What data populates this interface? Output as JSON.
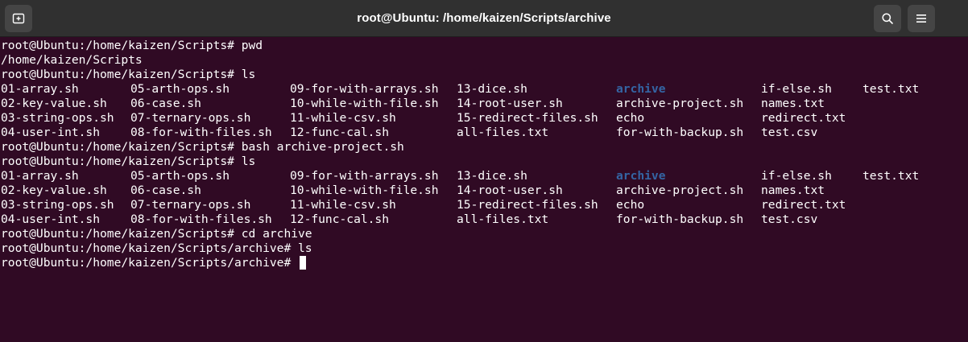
{
  "window": {
    "title": "root@Ubuntu: /home/kaizen/Scripts/archive"
  },
  "titlebar": {
    "new_tab_icon": "new-tab-icon",
    "search_icon": "search-icon",
    "menu_icon": "hamburger-menu-icon"
  },
  "colors": {
    "background": "#300a24",
    "titlebar": "#303030",
    "directory": "#3465a4",
    "text": "#ffffff"
  },
  "terminal": {
    "prompt1": "root@Ubuntu:/home/kaizen/Scripts# pwd",
    "output_pwd": "/home/kaizen/Scripts",
    "prompt2": "root@Ubuntu:/home/kaizen/Scripts# ls",
    "ls1": [
      [
        "01-array.sh",
        "05-arth-ops.sh",
        "09-for-with-arrays.sh",
        "13-dice.sh",
        "archive",
        "if-else.sh",
        "test.txt"
      ],
      [
        "02-key-value.sh",
        "06-case.sh",
        "10-while-with-file.sh",
        "14-root-user.sh",
        "archive-project.sh",
        "names.txt",
        ""
      ],
      [
        "03-string-ops.sh",
        "07-ternary-ops.sh",
        "11-while-csv.sh",
        "15-redirect-files.sh",
        "echo",
        "redirect.txt",
        ""
      ],
      [
        "04-user-int.sh",
        "08-for-with-files.sh",
        "12-func-cal.sh",
        "all-files.txt",
        "for-with-backup.sh",
        "test.csv",
        ""
      ]
    ],
    "prompt3": "root@Ubuntu:/home/kaizen/Scripts# bash archive-project.sh",
    "prompt4": "root@Ubuntu:/home/kaizen/Scripts# ls",
    "ls2": [
      [
        "01-array.sh",
        "05-arth-ops.sh",
        "09-for-with-arrays.sh",
        "13-dice.sh",
        "archive",
        "if-else.sh",
        "test.txt"
      ],
      [
        "02-key-value.sh",
        "06-case.sh",
        "10-while-with-file.sh",
        "14-root-user.sh",
        "archive-project.sh",
        "names.txt",
        ""
      ],
      [
        "03-string-ops.sh",
        "07-ternary-ops.sh",
        "11-while-csv.sh",
        "15-redirect-files.sh",
        "echo",
        "redirect.txt",
        ""
      ],
      [
        "04-user-int.sh",
        "08-for-with-files.sh",
        "12-func-cal.sh",
        "all-files.txt",
        "for-with-backup.sh",
        "test.csv",
        ""
      ]
    ],
    "prompt5": "root@Ubuntu:/home/kaizen/Scripts# cd archive",
    "prompt6": "root@Ubuntu:/home/kaizen/Scripts/archive# ls",
    "prompt7": "root@Ubuntu:/home/kaizen/Scripts/archive# "
  }
}
